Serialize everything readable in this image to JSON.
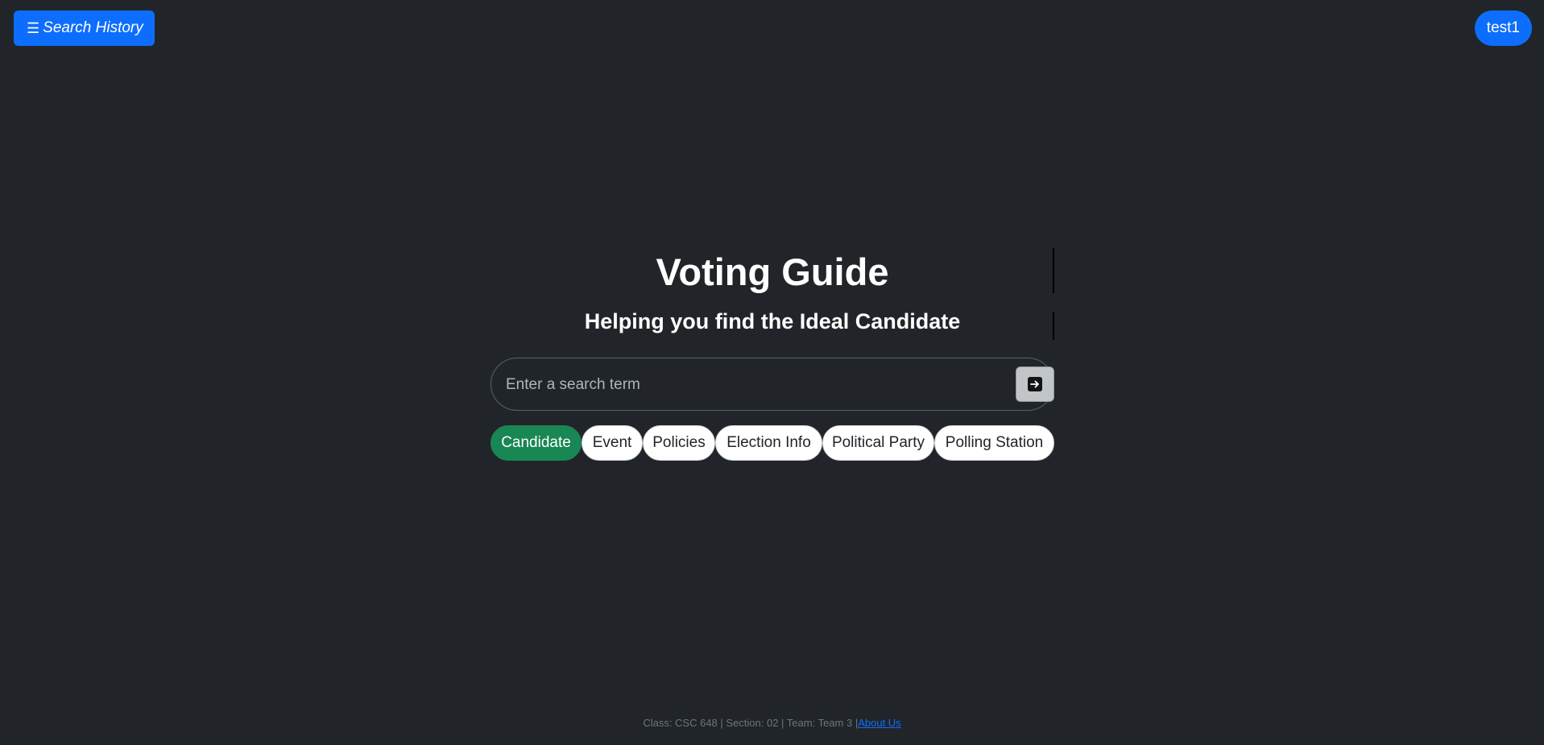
{
  "header": {
    "history_icon": "hamburger-icon",
    "history_label": "Search History",
    "user_label": "test1"
  },
  "hero": {
    "title": "Voting Guide",
    "subtitle": "Helping you find the Ideal Candidate"
  },
  "search": {
    "placeholder": "Enter a search term",
    "value": "",
    "submit_icon": "arrow-right-icon"
  },
  "categories": {
    "selected": "Candidate",
    "items": [
      {
        "label": "Candidate"
      },
      {
        "label": "Event"
      },
      {
        "label": "Policies"
      },
      {
        "label": "Election Info"
      },
      {
        "label": "Political Party"
      },
      {
        "label": "Polling Station"
      }
    ]
  },
  "footer": {
    "text": "Class: CSC 648 | Section: 02 | Team: Team 3 |",
    "link_label": "About Us"
  },
  "colors": {
    "background": "#212529",
    "primary": "#0d6efd",
    "selected_chip": "#198754",
    "chip": "#ffffff"
  }
}
